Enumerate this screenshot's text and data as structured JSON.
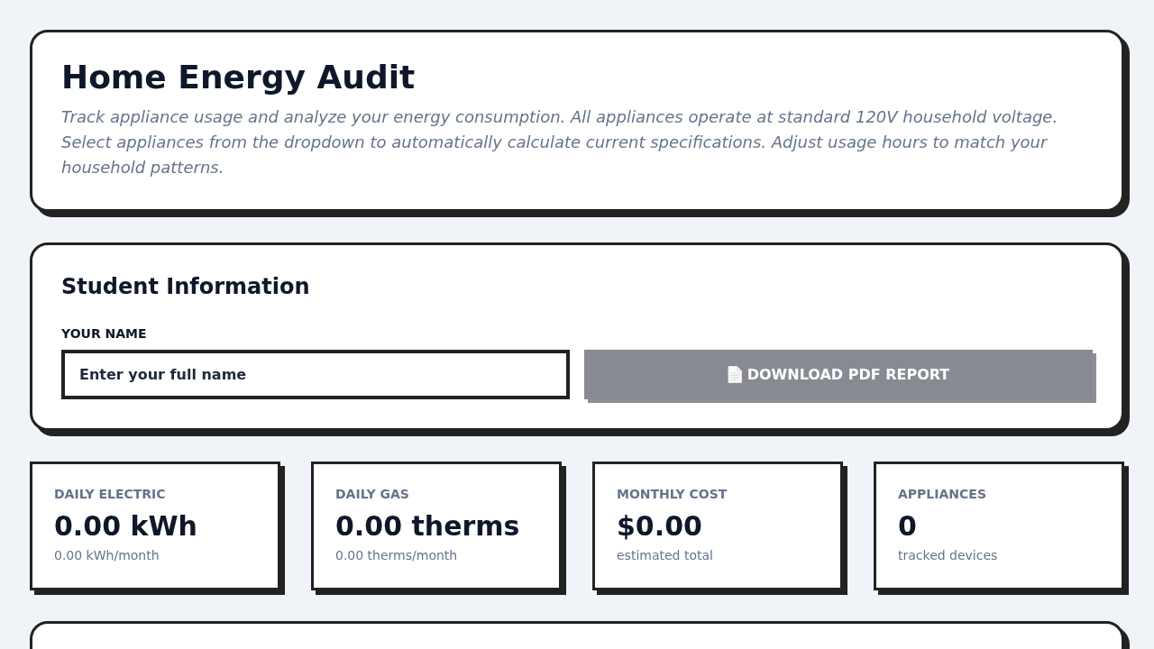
{
  "header": {
    "title": "Home Energy Audit",
    "description": "Track appliance usage and analyze your energy consumption. All appliances operate at standard 120V household voltage. Select appliances from the dropdown to automatically calculate current specifications. Adjust usage hours to match your household patterns."
  },
  "student_info": {
    "title": "Student Information",
    "name_field": {
      "label": "YOUR NAME",
      "placeholder": "Enter your full name"
    },
    "download_button": {
      "label": "DOWNLOAD PDF REPORT",
      "disabled": true
    }
  },
  "stats": [
    {
      "label": "DAILY ELECTRIC",
      "value": "0.00 kWh",
      "detail": "0.00 kWh/month"
    },
    {
      "label": "DAILY GAS",
      "value": "0.00 therms",
      "detail": "0.00 therms/month"
    },
    {
      "label": "MONTHLY COST",
      "value": "$0.00",
      "detail": "estimated total"
    },
    {
      "label": "APPLIANCES",
      "value": "0",
      "detail": "tracked devices"
    }
  ]
}
